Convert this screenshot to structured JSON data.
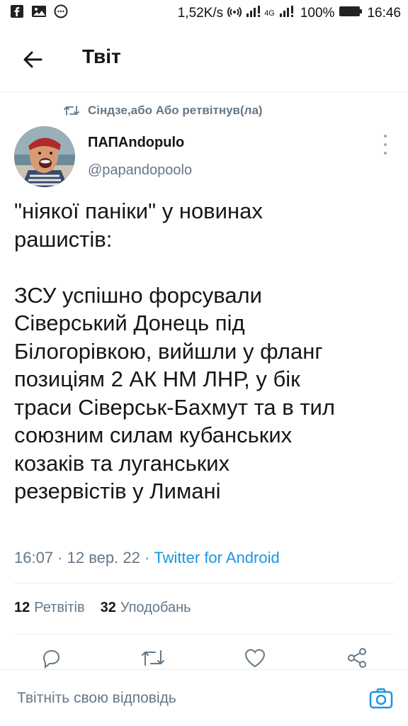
{
  "status_bar": {
    "speed": "1,52K/s",
    "network": "4G",
    "battery": "100%",
    "time": "16:46"
  },
  "header": {
    "title": "Твіт"
  },
  "retweet_context": {
    "text": "Сіндзе,або Або ретвітнув(ла)"
  },
  "tweet": {
    "author_name": "ПАПAndopulo",
    "author_handle": "@papandopoolo",
    "text": "\"ніякої паніки\" у новинах\nрашистів:\n\nЗСУ успішно форсували\nСіверський Донець під\nБілогорівкою, вийшли у фланг\nпозиціям 2 АК НМ ЛНР, у бік\nтраси Сіверськ-Бахмут та в тил\nсоюзним силам кубанських\nкозаків та луганських\nрезервістів у Лимані",
    "time": "16:07",
    "date": "12 вер. 22",
    "source": "Twitter for Android",
    "retweets_count": "12",
    "retweets_label": "Ретвітів",
    "likes_count": "32",
    "likes_label": "Уподобань"
  },
  "reply_bar": {
    "placeholder": "Твітніть свою відповідь"
  },
  "colors": {
    "link_blue": "#1b95e0",
    "muted_gray": "#657786",
    "text_dark": "#14171a",
    "divider": "#e6ecf0"
  },
  "icons": [
    "facebook-icon",
    "gallery-icon",
    "messenger-icon",
    "wifi-hotspot-icon",
    "signal-icon",
    "battery-icon",
    "back-arrow-icon",
    "retweet-icon",
    "more-options-icon",
    "reply-icon",
    "like-icon",
    "share-icon",
    "camera-icon"
  ]
}
